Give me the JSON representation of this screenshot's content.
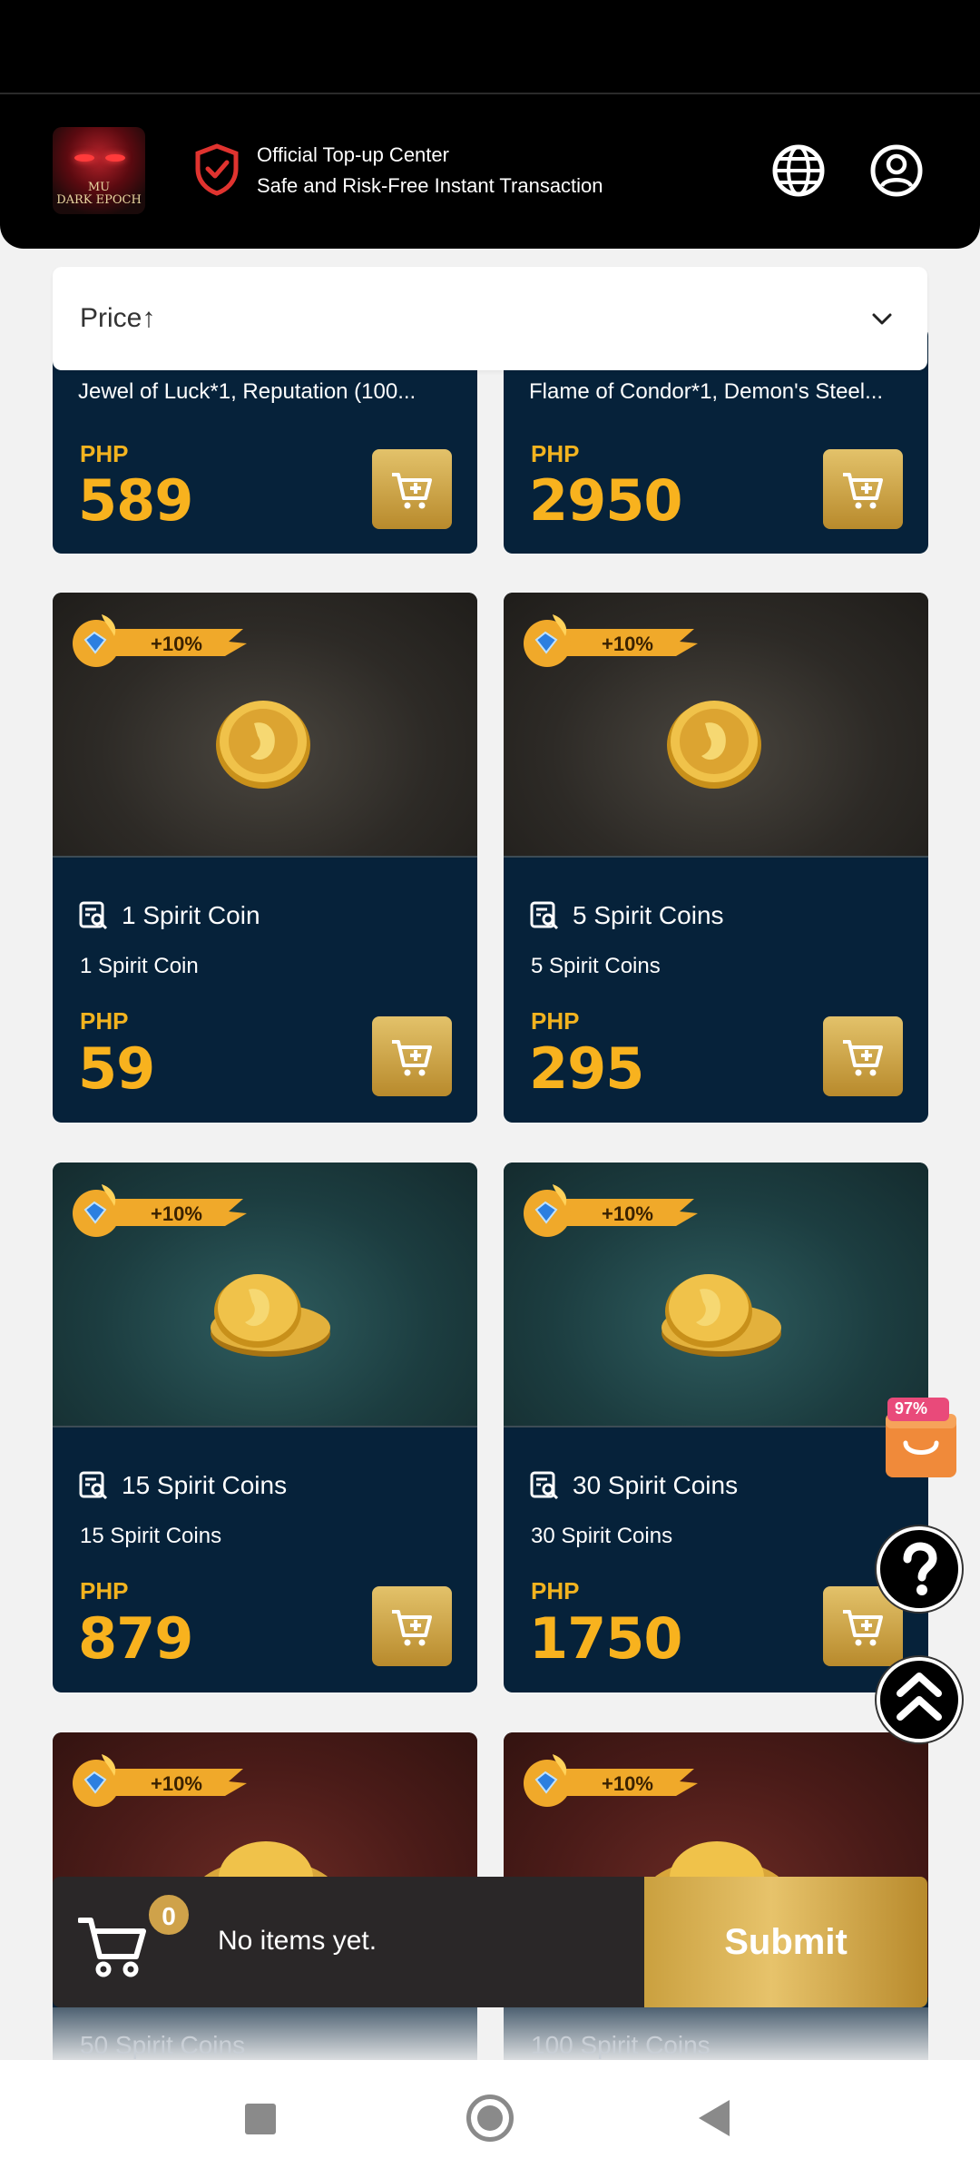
{
  "header": {
    "title": "Official Top-up Center",
    "subtitle": "Safe and Risk-Free Instant Transaction",
    "logo_text_1": "MU",
    "logo_text_2": "DARK EPOCH"
  },
  "sort": {
    "label": "Price↑"
  },
  "partial_cards": [
    {
      "desc": "Jewel of Luck*1, Reputation (100...",
      "currency": "PHP",
      "price": "589"
    },
    {
      "desc": "Flame of Condor*1, Demon's Steel...",
      "currency": "PHP",
      "price": "2950"
    }
  ],
  "cards": [
    {
      "badge": "+10%",
      "title": "1 Spirit Coin",
      "desc": "1 Spirit Coin",
      "currency": "PHP",
      "price": "59"
    },
    {
      "badge": "+10%",
      "title": "5 Spirit Coins",
      "desc": "5 Spirit Coins",
      "currency": "PHP",
      "price": "295"
    },
    {
      "badge": "+10%",
      "title": "15 Spirit Coins",
      "desc": "15 Spirit Coins",
      "currency": "PHP",
      "price": "879"
    },
    {
      "badge": "+10%",
      "title": "30 Spirit Coins",
      "desc": "30 Spirit Coins",
      "currency": "PHP",
      "price": "1750"
    },
    {
      "badge": "+10%",
      "title": "50 Spirit Coins"
    },
    {
      "badge": "+10%",
      "title": "100 Spirit Coins"
    }
  ],
  "promo": {
    "label": "97%"
  },
  "cartbar": {
    "count": "0",
    "empty_text": "No items yet.",
    "submit_label": "Submit"
  },
  "colors": {
    "card_bg": "#06223a",
    "price_gold": "#f8b21e",
    "submit_gold": "#e7c36b"
  }
}
